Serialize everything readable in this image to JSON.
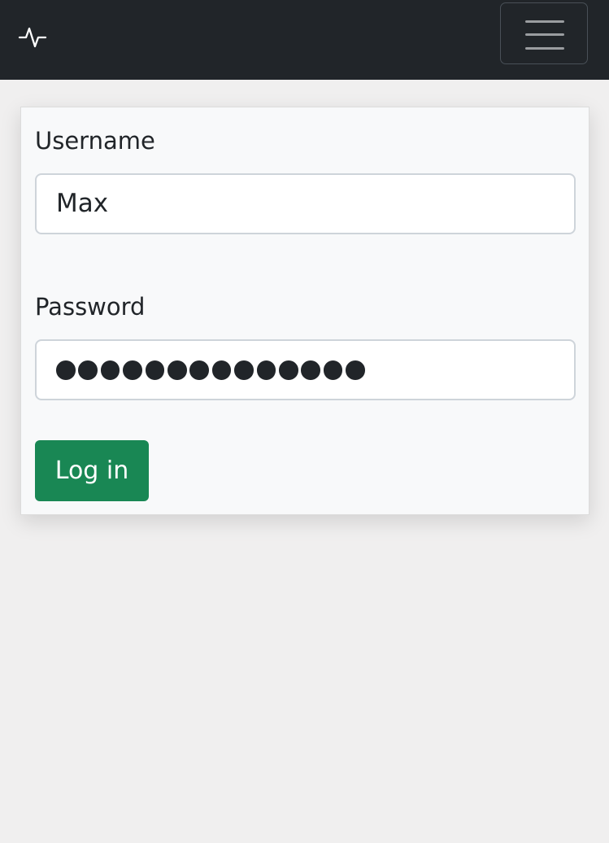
{
  "navbar": {
    "brand_icon": "activity-pulse-icon",
    "menu_icon": "hamburger-menu-icon"
  },
  "form": {
    "username_label": "Username",
    "username_value": "Max",
    "password_label": "Password",
    "password_length": 14,
    "login_label": "Log in"
  },
  "colors": {
    "navbar": "#212529",
    "page_background": "#f0efef",
    "card_background": "#f8f9fa",
    "login_button": "#198754"
  }
}
